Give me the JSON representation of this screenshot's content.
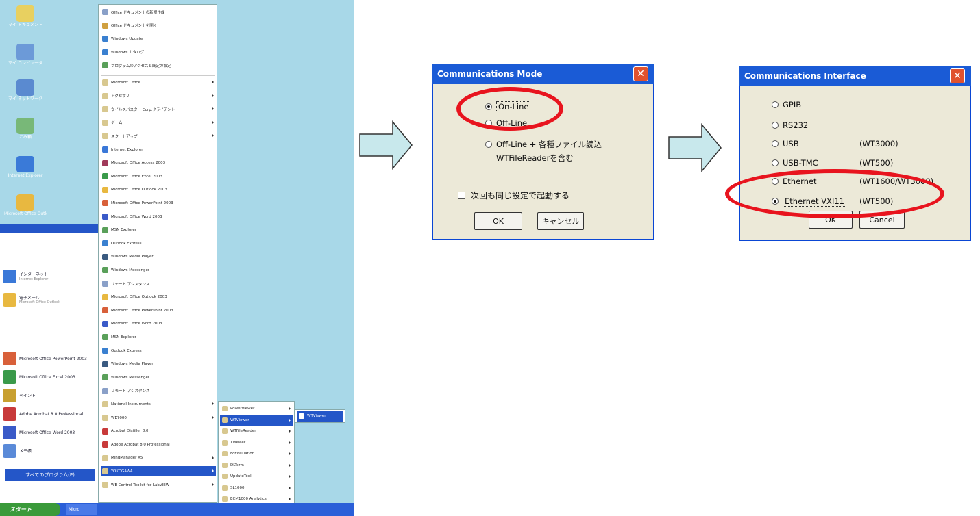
{
  "desktop_icons": [
    {
      "label": "マイ ドキュメント",
      "color": "#e8d060"
    },
    {
      "label": "マイ コンピュータ",
      "color": "#6c9ad8"
    },
    {
      "label": "マイ ネットワーク",
      "color": "#5a8ad0"
    },
    {
      "label": "ごみ箱",
      "color": "#78b878"
    },
    {
      "label": "Internet Explorer",
      "color": "#3a7ad8"
    },
    {
      "label": "Microsoft Office Outlook",
      "color": "#e8b840"
    }
  ],
  "start_left_pane": {
    "pinned": [
      {
        "label": "インターネット",
        "sub": "Internet Explorer",
        "color": "#3a78d8"
      },
      {
        "label": "電子メール",
        "sub": "Microsoft Office Outlook",
        "color": "#e8b840"
      }
    ],
    "recent": [
      {
        "label": "Microsoft Office PowerPoint 2003",
        "color": "#d8603a"
      },
      {
        "label": "Microsoft Office Excel 2003",
        "color": "#3a9a4a"
      },
      {
        "label": "ペイント",
        "color": "#c8a030"
      },
      {
        "label": "Adobe Acrobat 8.0 Professional",
        "color": "#c83a3a"
      },
      {
        "label": "Microsoft Office Word 2003",
        "color": "#3a5ac8"
      },
      {
        "label": "メモ帳",
        "color": "#5a8ad8"
      }
    ],
    "all_programs": "すべてのプログラム(P)"
  },
  "taskbar": {
    "start": "スタート",
    "item": "Micro"
  },
  "programs_menu": [
    {
      "label": "Office ドキュメントの新規作成",
      "color": "#8aa0c8",
      "arrow": false
    },
    {
      "label": "Office ドキュメントを開く",
      "color": "#d0a040",
      "arrow": false
    },
    {
      "label": "Windows Update",
      "color": "#3a80d0",
      "arrow": false
    },
    {
      "label": "Windows カタログ",
      "color": "#3a80d0",
      "arrow": false
    },
    {
      "label": "プログラムのアクセスと既定の設定",
      "color": "#5aa05a",
      "arrow": false
    },
    {
      "label": "Microsoft Office",
      "color": "#d8c890",
      "arrow": true
    },
    {
      "label": "アクセサリ",
      "color": "#d8c890",
      "arrow": true
    },
    {
      "label": "ウイルスバスター Corp.クライアント",
      "color": "#d8c890",
      "arrow": true
    },
    {
      "label": "ゲーム",
      "color": "#d8c890",
      "arrow": true
    },
    {
      "label": "スタートアップ",
      "color": "#d8c890",
      "arrow": true
    },
    {
      "label": "Internet Explorer",
      "color": "#3a78d8",
      "arrow": false
    },
    {
      "label": "Microsoft Office Access 2003",
      "color": "#a03a5a",
      "arrow": false
    },
    {
      "label": "Microsoft Office Excel 2003",
      "color": "#3a9a4a",
      "arrow": false
    },
    {
      "label": "Microsoft Office Outlook 2003",
      "color": "#e8b840",
      "arrow": false
    },
    {
      "label": "Microsoft Office PowerPoint 2003",
      "color": "#d8603a",
      "arrow": false
    },
    {
      "label": "Microsoft Office Word 2003",
      "color": "#3a5ac8",
      "arrow": false
    },
    {
      "label": "MSN Explorer",
      "color": "#5aa05a",
      "arrow": false
    },
    {
      "label": "Outlook Express",
      "color": "#3a80d0",
      "arrow": false
    },
    {
      "label": "Windows Media Player",
      "color": "#3a5a80",
      "arrow": false
    },
    {
      "label": "Windows Messenger",
      "color": "#5aa05a",
      "arrow": false
    },
    {
      "label": "リモート アシスタンス",
      "color": "#8aa0c8",
      "arrow": false
    },
    {
      "label": "Microsoft Office Outlook 2003",
      "color": "#e8b840",
      "arrow": false
    },
    {
      "label": "Microsoft Office PowerPoint 2003",
      "color": "#d8603a",
      "arrow": false
    },
    {
      "label": "Microsoft Office Word 2003",
      "color": "#3a5ac8",
      "arrow": false
    },
    {
      "label": "MSN Explorer",
      "color": "#5aa05a",
      "arrow": false
    },
    {
      "label": "Outlook Express",
      "color": "#3a80d0",
      "arrow": false
    },
    {
      "label": "Windows Media Player",
      "color": "#3a5a80",
      "arrow": false
    },
    {
      "label": "Windows Messenger",
      "color": "#5aa05a",
      "arrow": false
    },
    {
      "label": "リモート アシスタンス",
      "color": "#8aa0c8",
      "arrow": false
    },
    {
      "label": "National Instruments",
      "color": "#d8c890",
      "arrow": true
    },
    {
      "label": "WE7000",
      "color": "#d8c890",
      "arrow": true
    },
    {
      "label": "Acrobat Distiller 8.0",
      "color": "#c83a3a",
      "arrow": false
    },
    {
      "label": "Adobe Acrobat 8.0 Professional",
      "color": "#c83a3a",
      "arrow": false
    },
    {
      "label": "MindManager X5",
      "color": "#d8c890",
      "arrow": true
    },
    {
      "label": "YOKOGAWA",
      "color": "#d8c890",
      "arrow": true,
      "highlight": true
    },
    {
      "label": "WE Control Toolkit for LabVIEW",
      "color": "#d8c890",
      "arrow": true
    }
  ],
  "yokogawa_submenu": [
    {
      "label": "PowerViewer",
      "arrow": true
    },
    {
      "label": "WTViewer",
      "arrow": true,
      "highlight": true
    },
    {
      "label": "WTFileReader",
      "arrow": true
    },
    {
      "label": "Xviewer",
      "arrow": true
    },
    {
      "label": "FcEvaluation",
      "arrow": true
    },
    {
      "label": "DLTerm",
      "arrow": true
    },
    {
      "label": "UpdateTool",
      "arrow": true
    },
    {
      "label": "SL1000",
      "arrow": true
    },
    {
      "label": "ECM1000 Analytics",
      "arrow": true
    }
  ],
  "wtviewer_submenu": [
    {
      "label": "WTViewer",
      "highlight": true
    }
  ],
  "comm_mode_dialog": {
    "title": "Communications Mode",
    "close": "✕",
    "options": [
      {
        "label": "On-Line",
        "selected": true
      },
      {
        "label": "Off-Line",
        "selected": false
      },
      {
        "label": "Off-Line + 各種ファイル読込",
        "selected": false
      }
    ],
    "option3_line2": "WTFileReaderを含む",
    "checkbox_label": "次回も同じ設定で起動する",
    "ok": "OK",
    "cancel": "キャンセル"
  },
  "comm_interface_dialog": {
    "title": "Communications Interface",
    "close": "✕",
    "options": [
      {
        "label": "GPIB",
        "note": "",
        "selected": false
      },
      {
        "label": "RS232",
        "note": "",
        "selected": false
      },
      {
        "label": "USB",
        "note": "(WT3000)",
        "selected": false
      },
      {
        "label": "USB-TMC",
        "note": "(WT500)",
        "selected": false
      },
      {
        "label": "Ethernet",
        "note": "(WT1600/WT3000)",
        "selected": false
      },
      {
        "label": "Ethernet VXI11",
        "note": "(WT500)",
        "selected": true
      }
    ],
    "ok": "OK",
    "cancel": "Cancel"
  },
  "colors": {
    "highlight_red": "#e8141e",
    "arrow_fill": "#c8e8ec",
    "xp_blue": "#1a5bd6"
  }
}
